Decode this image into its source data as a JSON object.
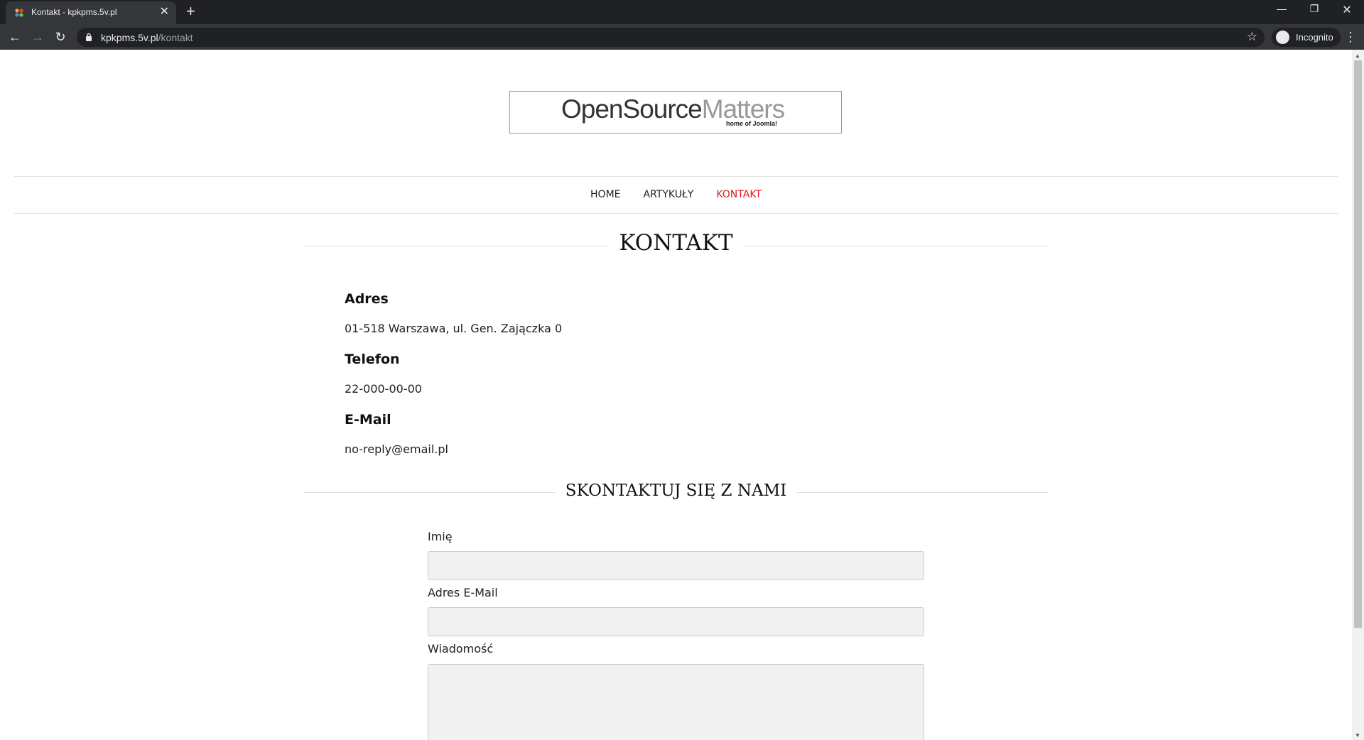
{
  "browser": {
    "tab_title": "Kontakt - kpkpms.5v.pl",
    "url_host": "kpkpms.5v.pl",
    "url_path": "/kontakt",
    "incognito_label": "Incognito",
    "icons": [
      "joomla-favicon",
      "close-icon",
      "plus-icon",
      "back-icon",
      "forward-icon",
      "reload-icon",
      "lock-icon",
      "star-icon",
      "incognito-icon",
      "kebab-menu-icon",
      "minimize-icon",
      "restore-icon"
    ]
  },
  "site": {
    "logo_open_source": "OpenSource",
    "logo_matters": "Matters",
    "logo_subtitle": "home of Joomla!",
    "nav": [
      {
        "label": "HOME",
        "active": false
      },
      {
        "label": "ARTYKUŁY",
        "active": false
      },
      {
        "label": "KONTAKT",
        "active": true
      }
    ],
    "accent_color": "#e21a1a"
  },
  "page": {
    "title": "KONTAKT",
    "address_heading": "Adres",
    "address_value": "01-518 Warszawa, ul. Gen. Zajączka 0",
    "phone_heading": "Telefon",
    "phone_value": "22-000-00-00",
    "email_heading": "E-Mail",
    "email_value": "no-reply@email.pl",
    "form_heading": "SKONTAKTUJ SIĘ Z NAMI",
    "form": {
      "name_label": "Imię",
      "name_value": "",
      "email_label": "Adres E-Mail",
      "email_value": "",
      "message_label": "Wiadomość",
      "message_value": ""
    }
  }
}
